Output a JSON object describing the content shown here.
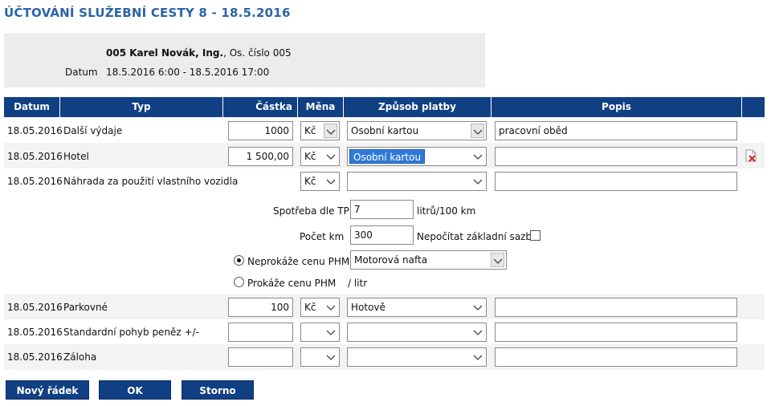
{
  "page": {
    "title": "ÚČTOVÁNÍ SLUŽEBNÍ CESTY 8 - 18.5.2016"
  },
  "employee": {
    "name": "005 Karel Novák, Ing.",
    "suffix": ", Os. číslo 005",
    "date_label": "Datum",
    "date_value": "18.5.2016 6:00 - 18.5.2016 17:00"
  },
  "table": {
    "headers": [
      "Datum",
      "Typ",
      "Částka",
      "Měna",
      "Způsob platby",
      "Popis"
    ],
    "rows": [
      {
        "date": "18.05.2016",
        "type": "Další výdaje",
        "amount": "1000",
        "currency": "Kč",
        "payment": "Osobní kartou",
        "description": "pracovní oběd"
      },
      {
        "date": "18.05.2016",
        "type": "Hotel",
        "amount": "1 500,00",
        "currency": "Kč",
        "payment": "Osobní kartou",
        "description": ""
      },
      {
        "date": "18.05.2016",
        "type": "Náhrada za použití vlastního vozidla",
        "amount": "",
        "currency": "Kč",
        "payment": "",
        "description": ""
      },
      {
        "date": "18.05.2016",
        "type": "Parkovné",
        "amount": "100",
        "currency": "Kč",
        "payment": "Hotově",
        "description": ""
      },
      {
        "date": "18.05.2016",
        "type": "Standardní pohyb peněz +/-",
        "amount": "",
        "currency": "",
        "payment": "",
        "description": ""
      },
      {
        "date": "18.05.2016",
        "type": "Záloha",
        "amount": "",
        "currency": "",
        "payment": "",
        "description": ""
      }
    ]
  },
  "vehicle": {
    "consumption_label": "Spotřeba dle TP",
    "consumption_value": "7",
    "consumption_unit": "litrů/100 km",
    "km_label": "Počet km",
    "km_value": "300",
    "no_base_rate_label": "Nepočítat základní sazbu",
    "radio_not_proven": "Neprokáže cenu PHM",
    "radio_proven": "Prokáže cenu PHM",
    "fuel_value": "Motorová nafta",
    "per_litre": "/ litr"
  },
  "buttons": {
    "new_row": "Nový řádek",
    "ok": "OK",
    "cancel": "Storno"
  },
  "colors": {
    "header_bg": "#103f83",
    "title": "#2a64a8",
    "selection": "#2f7ad9"
  },
  "icons": {
    "delete": "delete-row-icon",
    "dropdown": "chevron-down-icon"
  }
}
